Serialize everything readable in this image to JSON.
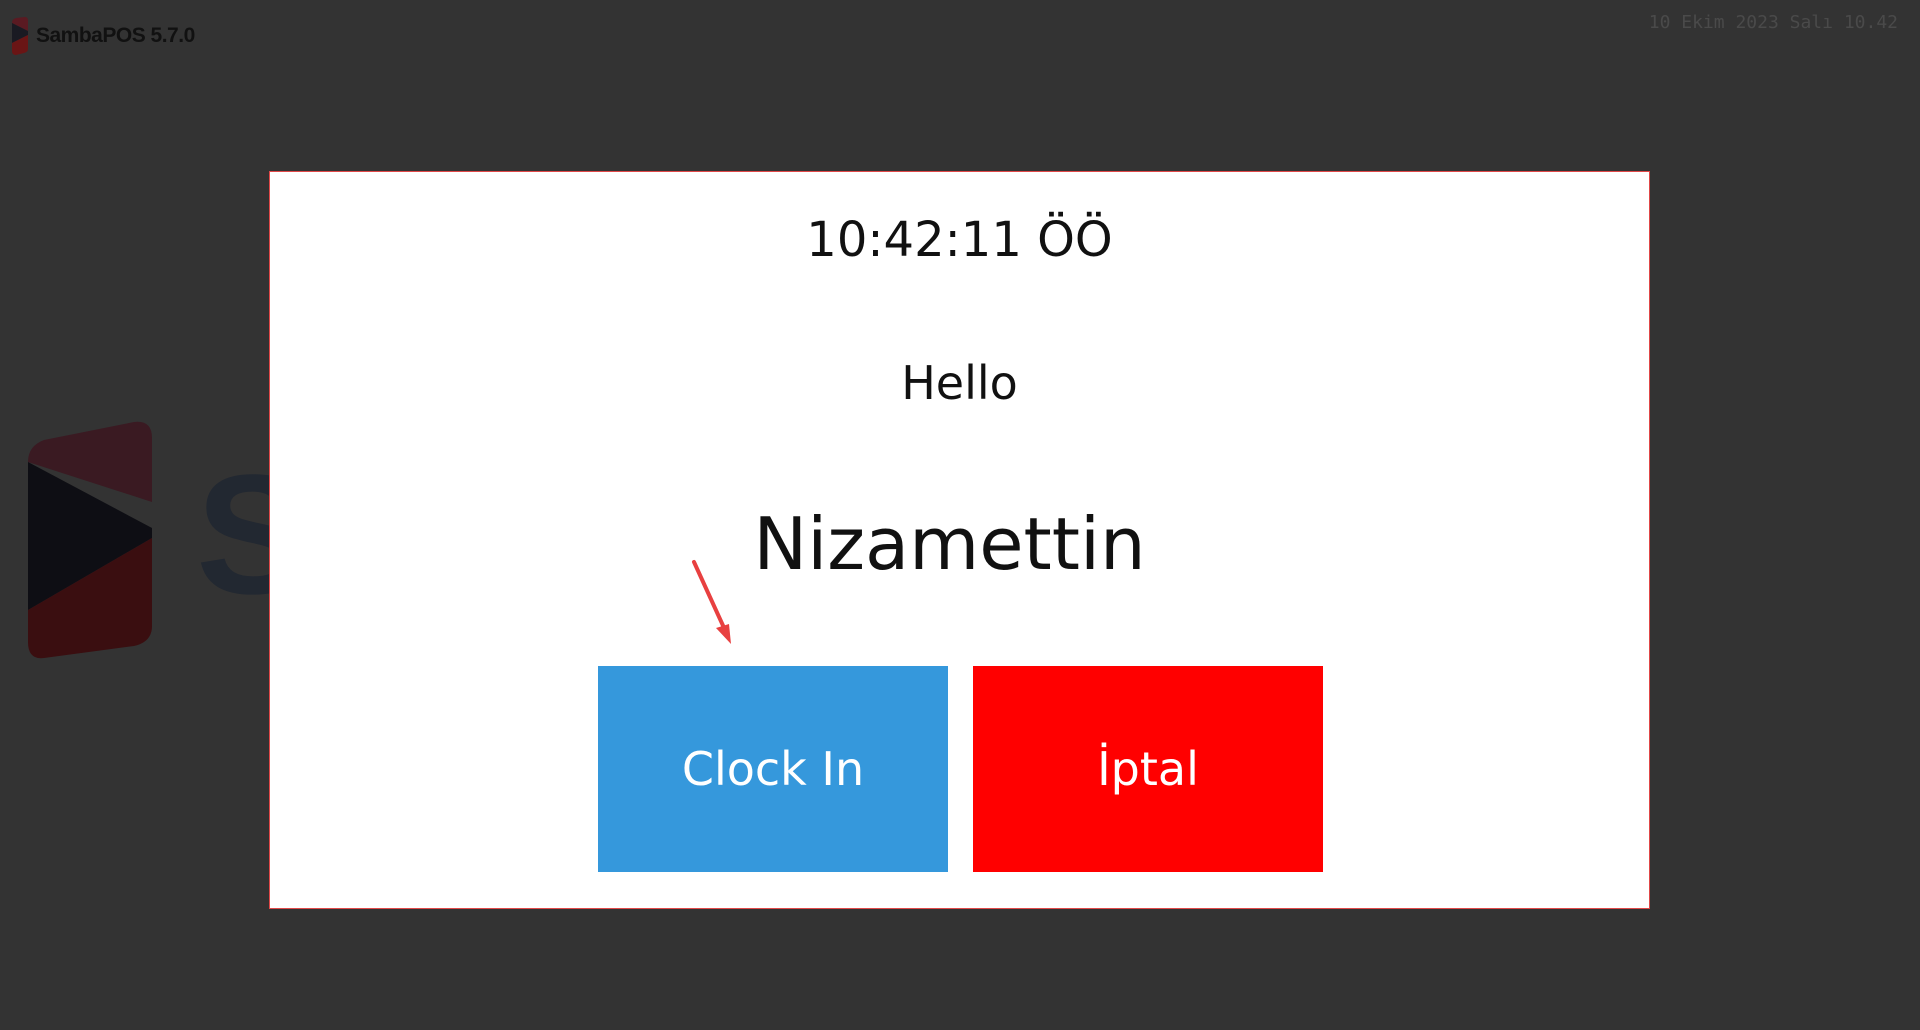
{
  "app": {
    "title": "SambaPOS 5.7.0",
    "datetime": "10 Ekim 2023 Salı 10.42"
  },
  "background": {
    "logo_word": "S"
  },
  "dialog": {
    "time": "10:42:11 ÖÖ",
    "greeting": "Hello",
    "user_name": "Nizamettin",
    "buttons": {
      "clock_in_label": "Clock In",
      "cancel_label": "İptal"
    }
  },
  "colors": {
    "background": "#333333",
    "clock_in_button": "#3598dc",
    "cancel_button": "#ff0000",
    "dialog_border": "#e04848",
    "annotation_arrow": "#e84040"
  },
  "icons": {
    "brand_logo": "sambapos-logo-icon",
    "annotation": "red-arrow-icon"
  }
}
